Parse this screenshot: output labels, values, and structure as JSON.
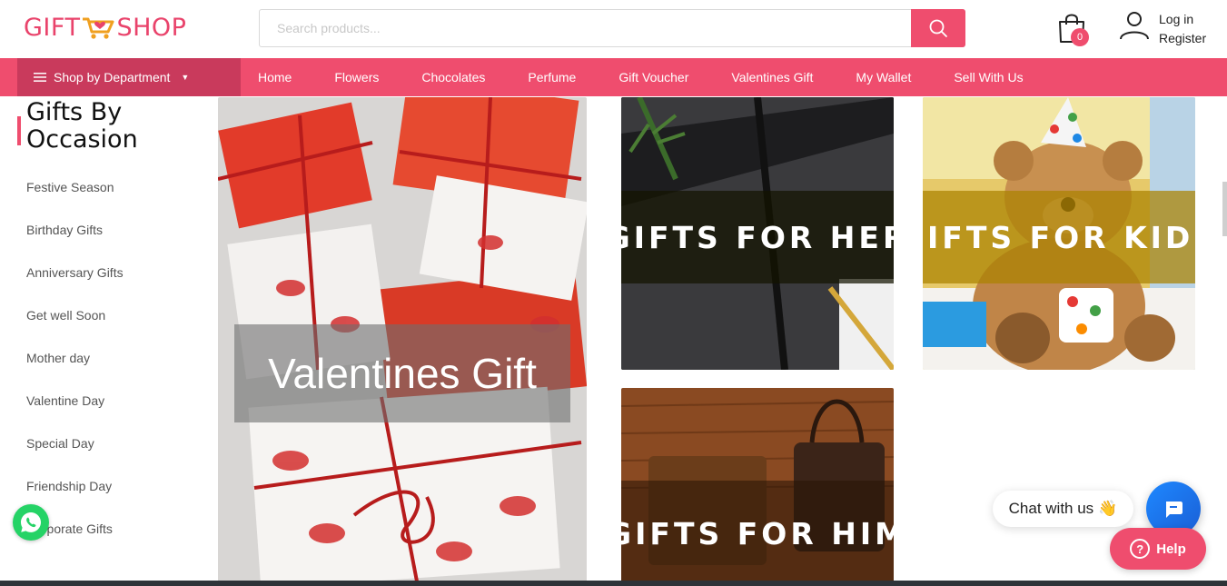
{
  "brand": {
    "part1": "GIFT",
    "part2": "SHOP",
    "logo_icon": "shopping-cart-heart-icon",
    "accent": "#ef4d6e"
  },
  "search": {
    "placeholder": "Search products...",
    "value": "",
    "icon": "search-icon"
  },
  "header": {
    "cart_count": "0",
    "login": "Log in",
    "register": "Register"
  },
  "nav": {
    "department": "Shop by Department",
    "links": [
      "Home",
      "Flowers",
      "Chocolates",
      "Perfume",
      "Gift Voucher",
      "Valentines Gift",
      "My Wallet",
      "Sell With Us"
    ]
  },
  "sidebar": {
    "title_line1": "Gifts By",
    "title_line2": "Occasion",
    "items": [
      "Festive Season",
      "Birthday Gifts",
      "Anniversary Gifts",
      "Get well Soon",
      "Mother day",
      "Valentine Day",
      "Special Day",
      "Friendship Day",
      "Corporate Gifts"
    ]
  },
  "tiles": {
    "valentines": "Valentines Gift",
    "her": "GIFTS FOR HER",
    "kids": "GIFTS FOR KIDS",
    "him": "GIFTS FOR HIM"
  },
  "widgets": {
    "chat_text": "Chat with us",
    "chat_emoji": "👋",
    "help": "Help"
  }
}
